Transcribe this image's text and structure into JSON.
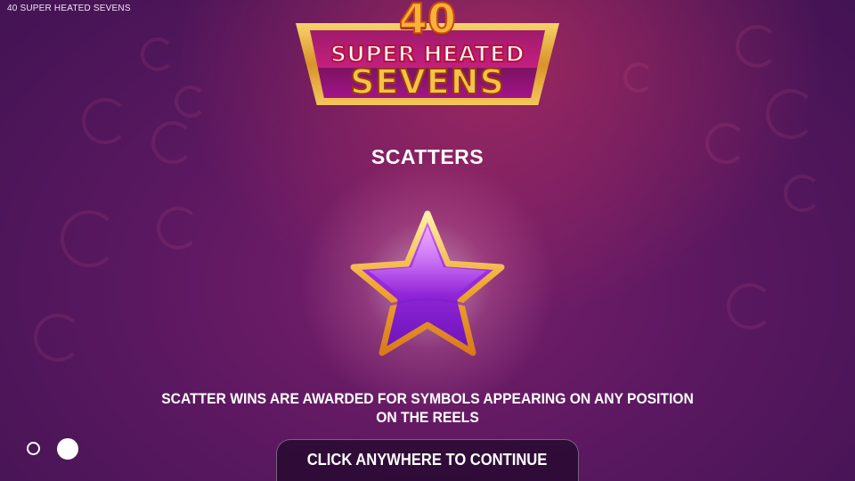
{
  "app": {
    "title": "40 SUPER HEATED SEVENS"
  },
  "logo": {
    "number": "40",
    "line1": "SUPER HEATED",
    "line2": "SEVENS"
  },
  "page": {
    "section_title": "SCATTERS",
    "symbol": "purple-star-icon",
    "description": "SCATTER WINS ARE AWARDED FOR SYMBOLS APPEARING ON ANY POSITION ON THE REELS"
  },
  "pagination": {
    "total": 2,
    "current": 2
  },
  "continue": {
    "label": "CLICK ANYWHERE TO CONTINUE"
  },
  "colors": {
    "background": "#5b1860",
    "gold": "#f4c75b",
    "star_purple": "#9b2be0"
  }
}
